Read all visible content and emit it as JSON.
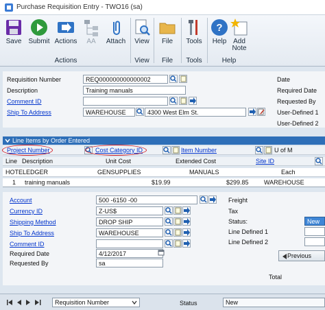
{
  "window": {
    "title": "Purchase Requisition Entry  -  TWO16 (sa)"
  },
  "ribbon": {
    "buttons": [
      {
        "label": "Save",
        "icon": "floppy-disk-icon"
      },
      {
        "label": "Submit",
        "icon": "play-arrow-icon"
      },
      {
        "label": "Actions",
        "icon": "actions-arrow-icon"
      },
      {
        "label": "AA",
        "icon": "hierarchy-icon"
      },
      {
        "label": "Attach",
        "icon": "paperclip-icon"
      },
      {
        "label": "View",
        "icon": "document-magnifier-icon"
      },
      {
        "label": "File",
        "icon": "folder-icon"
      },
      {
        "label": "Tools",
        "icon": "tools-icon"
      },
      {
        "label": "Help",
        "icon": "help-icon"
      },
      {
        "label": "Add",
        "label2": "Note",
        "icon": "add-note-icon"
      }
    ],
    "groups": {
      "actions": "Actions",
      "view": "View",
      "file": "File",
      "tools": "Tools",
      "help": "Help"
    }
  },
  "header": {
    "requisition_number_label": "Requisition Number",
    "requisition_number": "REQ000000000000002",
    "description_label": "Description",
    "description": "Training manuals",
    "comment_id_label": "Comment ID",
    "ship_to_label": "Ship To Address",
    "ship_to_code": "WAREHOUSE",
    "ship_to_address": "4300 West Elm St.",
    "right_labels": [
      "Date",
      "Required Date",
      "Requested By",
      "User-Defined 1",
      "User-Defined 2"
    ]
  },
  "lines": {
    "bar_title": "Line Items by Order Entered",
    "col_project": "Project Number",
    "col_cost_category": "Cost Category ID",
    "col_item": "Item Number",
    "col_uom": "U of M",
    "col_line": "Line",
    "col_description": "Description",
    "col_unit_cost": "Unit Cost",
    "col_extended": "Extended Cost",
    "col_site": "Site ID",
    "row_a": {
      "project": "HOTELEDGER",
      "cost_category": "GENSUPPLIES",
      "item": "MANUALS",
      "uom": "Each"
    },
    "row_b": {
      "line": "1",
      "description": "training manuals",
      "unit_cost": "$19.99",
      "extended": "$299.85",
      "site": "WAREHOUSE"
    }
  },
  "detail": {
    "account_label": "Account",
    "account": "500 -6150 -00",
    "currency_label": "Currency ID",
    "currency": "Z-US$",
    "shipping_label": "Shipping Method",
    "shipping": "DROP SHIP",
    "ship_to_label": "Ship To Address",
    "ship_to": "WAREHOUSE",
    "comment_label": "Comment ID",
    "required_date_label": "Required Date",
    "required_date": "4/12/2017",
    "requested_by_label": "Requested By",
    "requested_by": "sa",
    "right_labels": [
      "Freight",
      "Tax",
      "Status:",
      "Line Defined 1",
      "Line Defined 2"
    ],
    "status_value": "New",
    "previous_label": "Previous",
    "total_label": "Total"
  },
  "statusbar": {
    "sort": "Requisition Number",
    "status_label": "Status",
    "status_value": "New"
  },
  "colors": {
    "accent_blue": "#2e6fb8",
    "highlight_red": "#d4212a",
    "link": "#0033cc"
  }
}
